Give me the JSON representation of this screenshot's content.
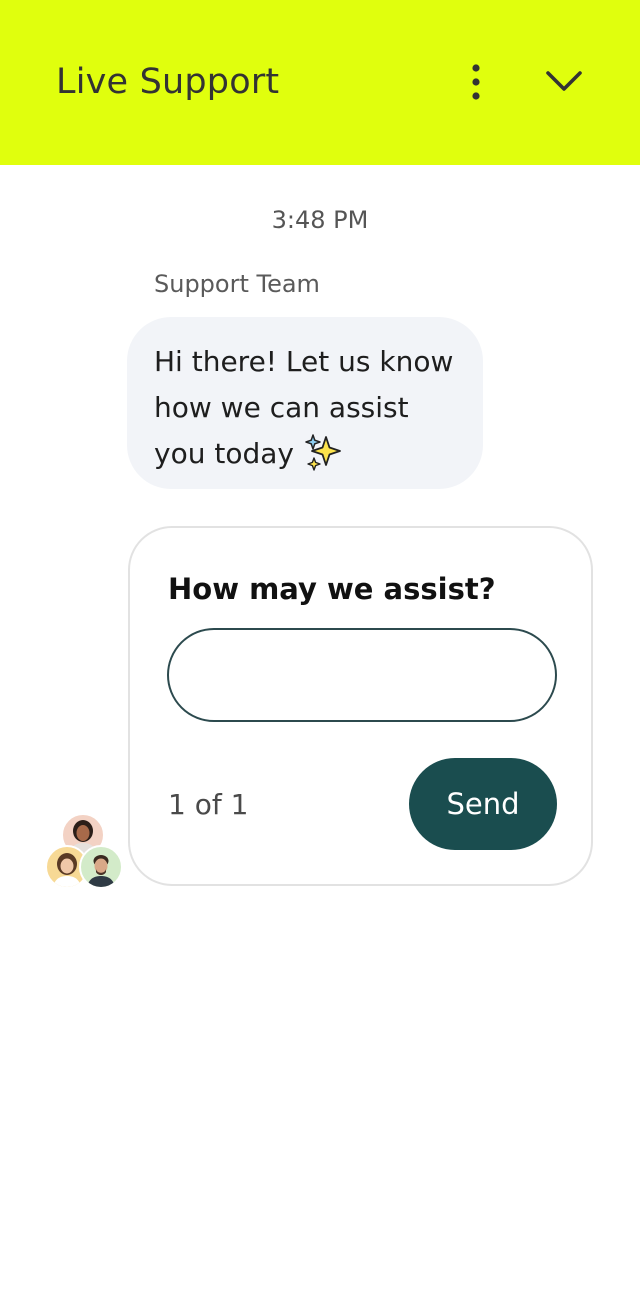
{
  "header": {
    "title": "Live Support",
    "background_color": "#e0ff0d",
    "menu_icon": "more-vertical-icon",
    "collapse_icon": "chevron-down-icon"
  },
  "conversation": {
    "timestamp": "3:48 PM",
    "sender": "Support Team",
    "message_lines": [
      "Hi there! Let us know",
      "how we can assist",
      "you today"
    ],
    "message_emoji": "sparkles-icon",
    "bubble_color": "#f2f4f8"
  },
  "form_card": {
    "title": "How may we assist?",
    "input_value": "",
    "input_placeholder": "",
    "pager": "1 of 1",
    "send_label": "Send",
    "send_color": "#1a4d4f"
  },
  "avatars": [
    "agent-avatar",
    "agent-avatar",
    "agent-avatar"
  ]
}
